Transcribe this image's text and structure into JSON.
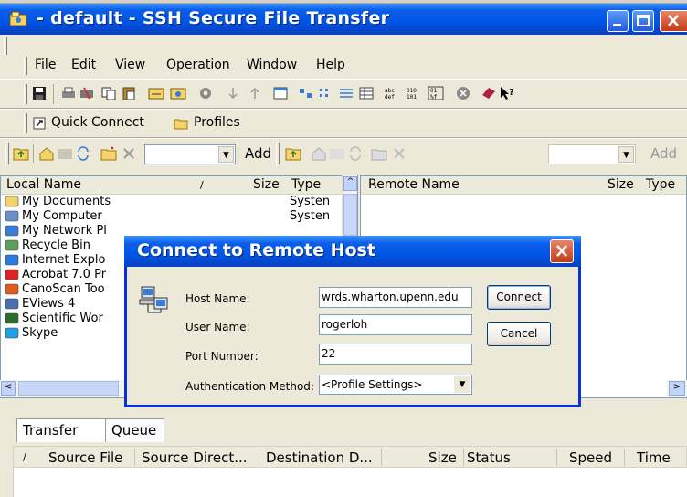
{
  "window": {
    "title": " - default - SSH Secure File Transfer"
  },
  "menu": [
    {
      "label": "File",
      "name": "menu-file"
    },
    {
      "label": "Edit",
      "name": "menu-edit"
    },
    {
      "label": "View",
      "name": "menu-view"
    },
    {
      "label": "Operation",
      "name": "menu-operation"
    },
    {
      "label": "Window",
      "name": "menu-window"
    },
    {
      "label": "Help",
      "name": "menu-help"
    }
  ],
  "quickbar": {
    "quick_connect": "Quick Connect",
    "profiles": "Profiles"
  },
  "pathbar": {
    "add_left": "Add",
    "add_right": "Add"
  },
  "local": {
    "columns": {
      "name": "Local Name",
      "size": "Size",
      "type": "Type"
    },
    "files": [
      {
        "name": "My Documents",
        "type": "Systen",
        "icon": "folder-icon"
      },
      {
        "name": "My Computer",
        "type": "Systen",
        "icon": "computer-icon"
      },
      {
        "name": "My Network Pl",
        "type": "",
        "icon": "network-icon"
      },
      {
        "name": "Recycle Bin",
        "type": "",
        "icon": "recycle-bin-icon"
      },
      {
        "name": "Internet Explo",
        "type": "",
        "icon": "internet-explorer-icon"
      },
      {
        "name": "Acrobat 7.0 Pr",
        "type": "",
        "icon": "acrobat-icon"
      },
      {
        "name": "CanoScan Too",
        "type": "",
        "icon": "canoscan-icon"
      },
      {
        "name": "EViews 4",
        "type": "",
        "icon": "eviews-icon"
      },
      {
        "name": "Scientific Wor",
        "type": "",
        "icon": "scientific-word-icon"
      },
      {
        "name": "Skype",
        "type": "",
        "icon": "skype-icon"
      }
    ]
  },
  "remote": {
    "columns": {
      "name": "Remote Name",
      "size": "Size",
      "type": "Type"
    }
  },
  "tabs": {
    "transfer": "Transfer",
    "queue": "Queue"
  },
  "transfer_columns": {
    "source_file": "Source File",
    "source_dir": "Source Direct...",
    "dest_dir": "Destination D...",
    "size": "Size",
    "status": "Status",
    "speed": "Speed",
    "time": "Time"
  },
  "dialog": {
    "title": "Connect to Remote Host",
    "host_label": "Host Name:",
    "host_value": "wrds.wharton.upenn.edu",
    "user_label": "User Name:",
    "user_value": "rogerloh",
    "port_label": "Port Number:",
    "port_value": "22",
    "auth_label": "Authentication Method:",
    "auth_value": "<Profile Settings>",
    "connect": "Connect",
    "cancel": "Cancel"
  },
  "colors": {
    "titlebar": "#0054e3",
    "dialog_border": "#0831d9",
    "close_red": "#c23b15",
    "chrome": "#ece9d8"
  }
}
